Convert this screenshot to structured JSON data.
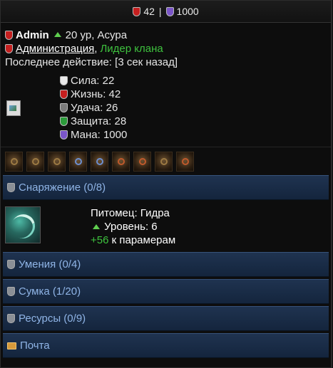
{
  "topbar": {
    "health_value": "42",
    "separator": "|",
    "mana_value": "1000"
  },
  "profile": {
    "name": "Admin",
    "level_text": "20 ур, Асура",
    "role": "Администрация",
    "comma": ",",
    "clan_rank": "Лидер клана",
    "last_action": "Последнее действие: [3 сек назад]"
  },
  "stats": [
    {
      "label": "Сила: 22",
      "icon": "strength-icon",
      "color": "#e9e9e9"
    },
    {
      "label": "Жизнь: 42",
      "icon": "health-icon",
      "color": "#c51f1f"
    },
    {
      "label": "Удача: 26",
      "icon": "luck-icon",
      "color": "#7a7a7a"
    },
    {
      "label": "Защита: 28",
      "icon": "defense-icon",
      "color": "#2b9a3a"
    },
    {
      "label": "Мана: 1000",
      "icon": "mana-icon",
      "color": "#7a55c8"
    }
  ],
  "equipment_icons": [
    "item-slot-1",
    "item-slot-2",
    "item-slot-3",
    "item-slot-4",
    "item-slot-5",
    "item-slot-6",
    "item-slot-7",
    "item-slot-8",
    "item-slot-9"
  ],
  "sections": {
    "equipment": "Снаряжение (0/8)",
    "skills": "Умения (0/4)",
    "bag": "Сумка (1/20)",
    "resources": "Ресурсы (0/9)",
    "mail": "Почта"
  },
  "pet": {
    "title": "Питомец: Гидра",
    "level": "Уровень: 6",
    "bonus_value": "+56",
    "bonus_text": "к парамерам"
  },
  "colors": {
    "accent_blue": "#8fb4e6",
    "clan_green": "#3ec23e",
    "bar_bg": "#1f3350"
  }
}
